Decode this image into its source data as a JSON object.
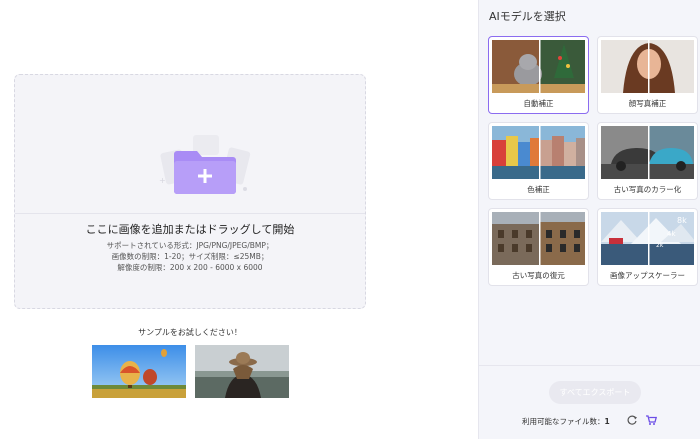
{
  "dropzone": {
    "title": "ここに画像を追加またはドラッグして開始",
    "formats": "サポートされている形式：JPG/PNG/JPEG/BMP；",
    "limits": "画像数の制限：1-20；サイズ制限：≤25MB；",
    "resolution": "解像度の制限：200 x 200 - 6000 x 6000",
    "add_icon": "folder-plus-icon"
  },
  "samples": {
    "label": "サンプルをお試しください！",
    "items": [
      {
        "name": "balloons"
      },
      {
        "name": "woman-hat"
      }
    ]
  },
  "panel": {
    "title": "AIモデルを選択",
    "models": [
      {
        "label": "自動補正",
        "selected": true
      },
      {
        "label": "顔写真補正",
        "selected": false
      },
      {
        "label": "色補正",
        "selected": false
      },
      {
        "label": "古い写真のカラー化",
        "selected": false
      },
      {
        "label": "古い写真の復元",
        "selected": false
      },
      {
        "label": "画像アップスケーラー",
        "selected": false
      }
    ],
    "upscale_badges": [
      "8k",
      "4k",
      "2k"
    ]
  },
  "footer": {
    "export_label": "すべてエクスポート",
    "available_label": "利用可能なファイル数：",
    "available_count": "1",
    "refresh_icon": "refresh-icon",
    "cart_icon": "cart-icon"
  },
  "colors": {
    "accent": "#8b6cf0",
    "folder": "#a98cf5",
    "panel_bg": "#f4f5fa",
    "dropzone_bg": "#f4f4f8",
    "cart": "#6b4de6"
  }
}
